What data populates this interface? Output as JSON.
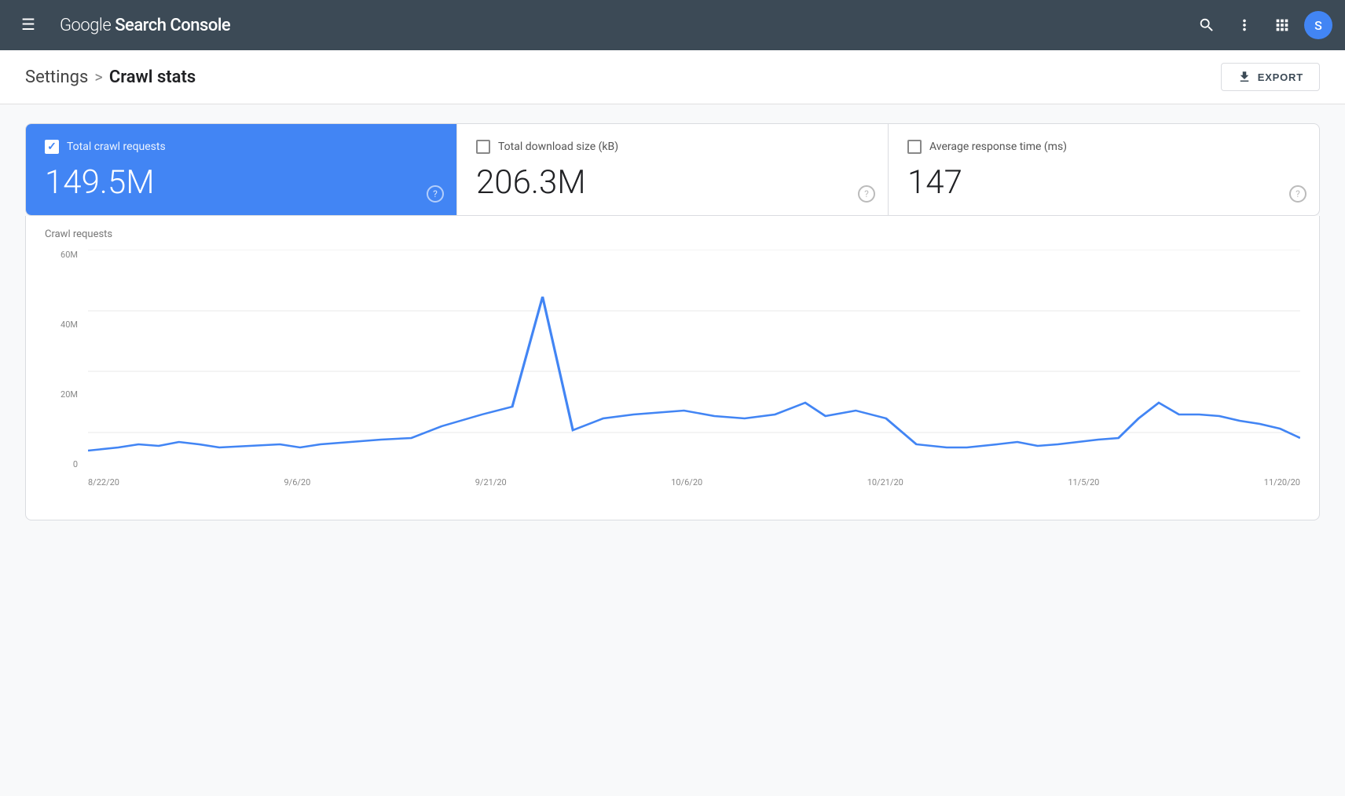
{
  "header": {
    "title_google": "Google",
    "title_rest": " Search Console",
    "menu_icon": "☰",
    "search_icon": "🔍",
    "more_icon": "⋮",
    "apps_icon": "⊞",
    "avatar_label": "S"
  },
  "breadcrumb": {
    "settings_label": "Settings",
    "separator": ">",
    "current_label": "Crawl stats"
  },
  "export_button": "EXPORT",
  "stats": [
    {
      "id": "crawl-requests",
      "label": "Total crawl requests",
      "value": "149.5M",
      "active": true
    },
    {
      "id": "download-size",
      "label": "Total download size (kB)",
      "value": "206.3M",
      "active": false
    },
    {
      "id": "response-time",
      "label": "Average response time (ms)",
      "value": "147",
      "active": false
    }
  ],
  "chart": {
    "title": "Crawl requests",
    "y_labels": [
      "0",
      "20M",
      "40M",
      "60M"
    ],
    "x_labels": [
      "8/22/20",
      "9/6/20",
      "9/21/20",
      "10/6/20",
      "10/21/20",
      "11/5/20",
      "11/20/20"
    ],
    "line_color": "#4285f4",
    "max_value": 60
  }
}
